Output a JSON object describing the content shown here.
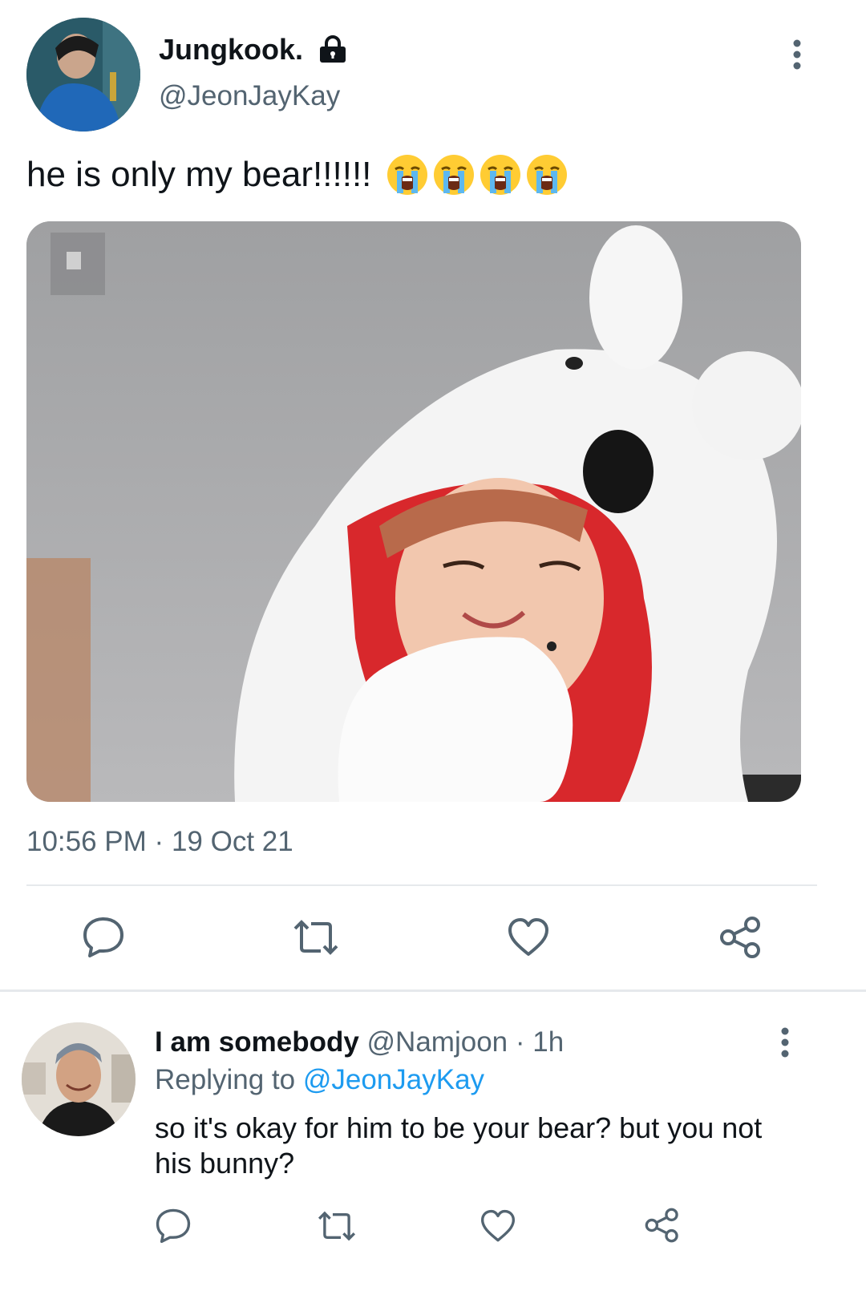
{
  "tweet": {
    "display_name": "Jungkook.",
    "handle": "@JeonJayKay",
    "text": "he is only my bear!!!!!!",
    "emoji": [
      "loudly-crying-face",
      "loudly-crying-face",
      "loudly-crying-face",
      "loudly-crying-face"
    ],
    "timestamp": "10:56 PM",
    "date": "19 Oct 21"
  },
  "reply": {
    "display_name": "I am somebody",
    "handle": "@Namjoon",
    "time": "1h",
    "replying_label": "Replying to",
    "replying_handle": "@JeonJayKay",
    "text": "so it's okay for him to be your bear? but you not his bunny?"
  },
  "icons": {
    "lock": "lock-icon",
    "more": "more-vertical-icon",
    "reply": "reply-icon",
    "retweet": "retweet-icon",
    "like": "heart-icon",
    "share": "share-icon"
  },
  "colors": {
    "text": "#0f1419",
    "muted": "#536471",
    "link": "#1d9bf0",
    "divider": "#e6e9ec"
  }
}
